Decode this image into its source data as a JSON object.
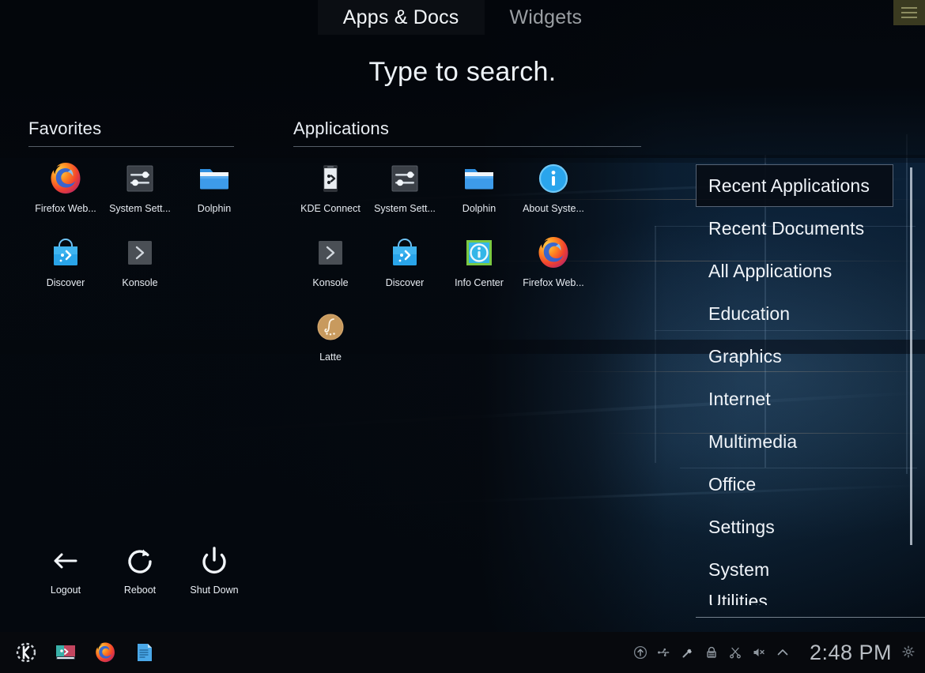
{
  "window": {
    "tabs": [
      {
        "label": "Apps & Docs",
        "selected": true
      },
      {
        "label": "Widgets",
        "selected": false
      }
    ],
    "menu_button_icon": "hamburger-menu-icon",
    "menu_button_color": "#3a3a20"
  },
  "search": {
    "heading": "Type to search.",
    "placeholder": "Type to search."
  },
  "favorites": {
    "title": "Favorites",
    "items": [
      {
        "label": "Firefox Web...",
        "icon": "firefox-icon"
      },
      {
        "label": "System Sett...",
        "icon": "system-settings-icon"
      },
      {
        "label": "Dolphin",
        "icon": "dolphin-folder-icon"
      },
      {
        "label": "Discover",
        "icon": "discover-bag-icon"
      },
      {
        "label": "Konsole",
        "icon": "konsole-terminal-icon"
      }
    ]
  },
  "applications": {
    "title": "Applications",
    "items": [
      {
        "label": "KDE Connect",
        "icon": "kde-connect-phone-icon"
      },
      {
        "label": "System Sett...",
        "icon": "system-settings-icon"
      },
      {
        "label": "Dolphin",
        "icon": "dolphin-folder-icon"
      },
      {
        "label": "About Syste...",
        "icon": "about-system-info-icon"
      },
      {
        "label": "Konsole",
        "icon": "konsole-terminal-icon"
      },
      {
        "label": "Discover",
        "icon": "discover-bag-icon"
      },
      {
        "label": "Info Center",
        "icon": "info-center-icon"
      },
      {
        "label": "Firefox Web...",
        "icon": "firefox-icon"
      },
      {
        "label": "Latte",
        "icon": "latte-dock-icon"
      }
    ]
  },
  "power": {
    "items": [
      {
        "label": "Logout",
        "icon": "arrow-left-icon"
      },
      {
        "label": "Reboot",
        "icon": "refresh-circular-arrow-icon"
      },
      {
        "label": "Shut Down",
        "icon": "power-icon"
      }
    ]
  },
  "categories": {
    "items": [
      {
        "label": "Recent Applications",
        "active": true
      },
      {
        "label": "Recent Documents",
        "active": false
      },
      {
        "label": "All Applications",
        "active": false
      },
      {
        "label": "Education",
        "active": false
      },
      {
        "label": "Graphics",
        "active": false
      },
      {
        "label": "Internet",
        "active": false
      },
      {
        "label": "Multimedia",
        "active": false
      },
      {
        "label": "Office",
        "active": false
      },
      {
        "label": "Settings",
        "active": false
      },
      {
        "label": "System",
        "active": false
      },
      {
        "label": "Utilities",
        "active": false
      }
    ]
  },
  "taskbar": {
    "launchers": [
      {
        "name": "kde-application-launcher-icon"
      },
      {
        "name": "spectacle-screenshot-icon"
      },
      {
        "name": "firefox-icon"
      },
      {
        "name": "text-document-icon"
      }
    ],
    "tray": [
      {
        "name": "software-update-icon"
      },
      {
        "name": "usb-device-icon"
      },
      {
        "name": "bluetooth-connector-icon"
      },
      {
        "name": "lock-padlock-icon"
      },
      {
        "name": "clipboard-scissors-icon"
      },
      {
        "name": "volume-muted-icon"
      },
      {
        "name": "tray-expand-chevron-up-icon"
      }
    ],
    "clock": "2:48 PM",
    "settings_icon": "gear-icon"
  },
  "colors": {
    "accent_blue": "#3daee9",
    "selected_tab_bg": "#0b0e13",
    "menu_button": "#3a3a20",
    "text_primary": "#f0f4f9",
    "text_muted": "#9a9ea3"
  }
}
